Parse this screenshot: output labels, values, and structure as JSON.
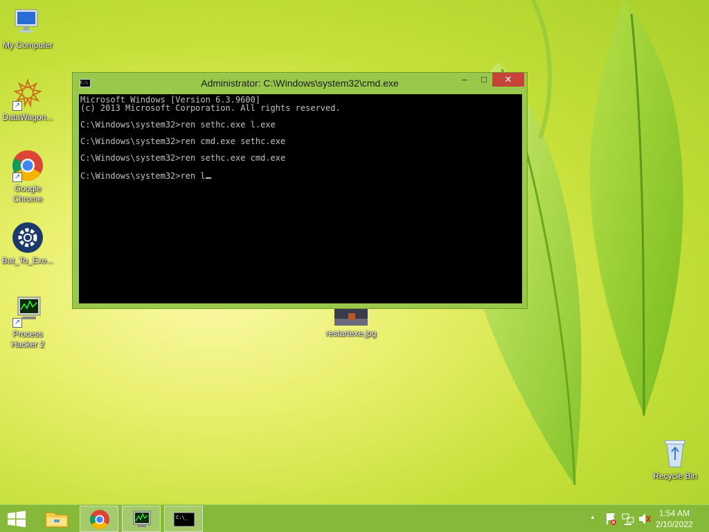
{
  "desktop": {
    "icons": [
      {
        "label": "My Computer",
        "icon": "computer-icon"
      },
      {
        "label": "DataWagon...",
        "icon": "datawagon-icon"
      },
      {
        "label": "Google Chrome",
        "icon": "chrome-icon"
      },
      {
        "label": "Bat_To_Exe...",
        "icon": "gear-icon"
      },
      {
        "label": "Process Hacker 2",
        "icon": "process-hacker-icon"
      },
      {
        "label": "restartexe.jpg",
        "icon": "image-file-icon"
      },
      {
        "label": "Recycle Bin",
        "icon": "recycle-bin-icon"
      }
    ]
  },
  "window": {
    "title": "Administrator: C:\\Windows\\system32\\cmd.exe",
    "minimize": "–",
    "maximize": "□",
    "close": "✕",
    "console_lines": [
      "Microsoft Windows [Version 6.3.9600]",
      "(c) 2013 Microsoft Corporation. All rights reserved.",
      "",
      "C:\\Windows\\system32>ren sethc.exe l.exe",
      "",
      "C:\\Windows\\system32>ren cmd.exe sethc.exe",
      "",
      "C:\\Windows\\system32>ren sethc.exe cmd.exe",
      "",
      "C:\\Windows\\system32>ren l"
    ]
  },
  "taskbar": {
    "start_icon": "windows-logo-icon",
    "items": [
      "file-explorer-icon",
      "chrome-icon",
      "process-hacker-icon",
      "cmd-icon"
    ],
    "tray": {
      "show_hidden": "▲",
      "icons": [
        "action-center-flag-icon",
        "network-icon",
        "volume-muted-icon"
      ],
      "time": "1:54 AM",
      "date": "2/10/2022"
    }
  },
  "colors": {
    "accent": "#9ac84a",
    "close_button": "#c7433a",
    "taskbar": "#86b93a"
  }
}
